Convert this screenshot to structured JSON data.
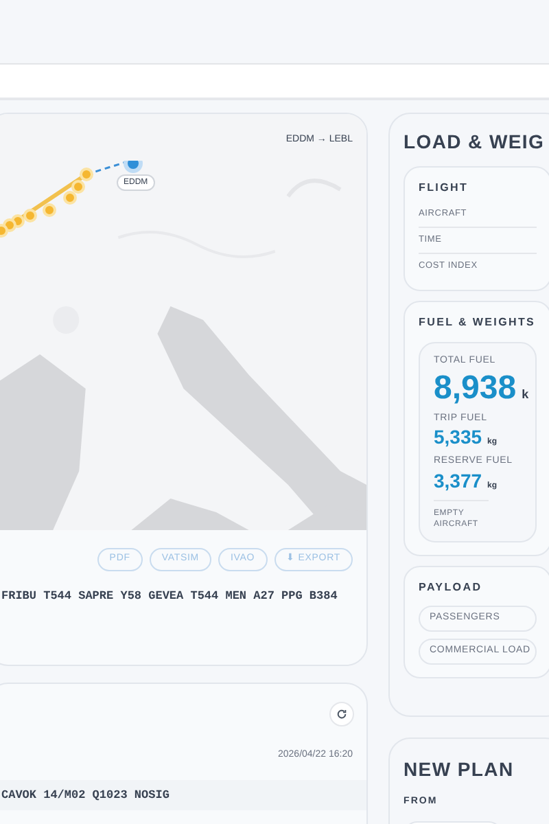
{
  "map": {
    "kind": "picture",
    "route_label": "EDDM → LEBL",
    "origin_label": "EDDM"
  },
  "export_buttons": [
    "PDF",
    "VATSIM",
    "IVAO",
    "⬇ EXPORT"
  ],
  "route": "FRIBU T544 SAPRE Y58 GEVEA T544 MEN A27 PPG B384",
  "weather": {
    "timestamp": "2026/04/22 16:20",
    "metar": "CAVOK 14/M02 Q1023 NOSIG"
  },
  "load_panel": {
    "title": "LOAD & WEIG",
    "flight": {
      "title": "FLIGHT",
      "rows": [
        "AIRCRAFT",
        "TIME",
        "COST INDEX"
      ]
    },
    "fuel": {
      "title": "FUEL & WEIGHTS",
      "items": [
        {
          "label": "TOTAL FUEL",
          "value": "8,938",
          "unit": "k",
          "kind": "large"
        },
        {
          "label": "TRIP FUEL",
          "value": "5,335",
          "unit": "kg",
          "kind": "small"
        },
        {
          "label": "RESERVE FUEL",
          "value": "3,377",
          "unit": "kg",
          "kind": "small"
        }
      ],
      "footer": "EMPTY AIRCRAFT"
    },
    "payload": {
      "title": "PAYLOAD",
      "fields": [
        "PASSENGERS",
        "COMMERCIAL LOAD"
      ]
    }
  },
  "new_plan": {
    "title": "NEW PLAN",
    "from_label": "FROM"
  }
}
